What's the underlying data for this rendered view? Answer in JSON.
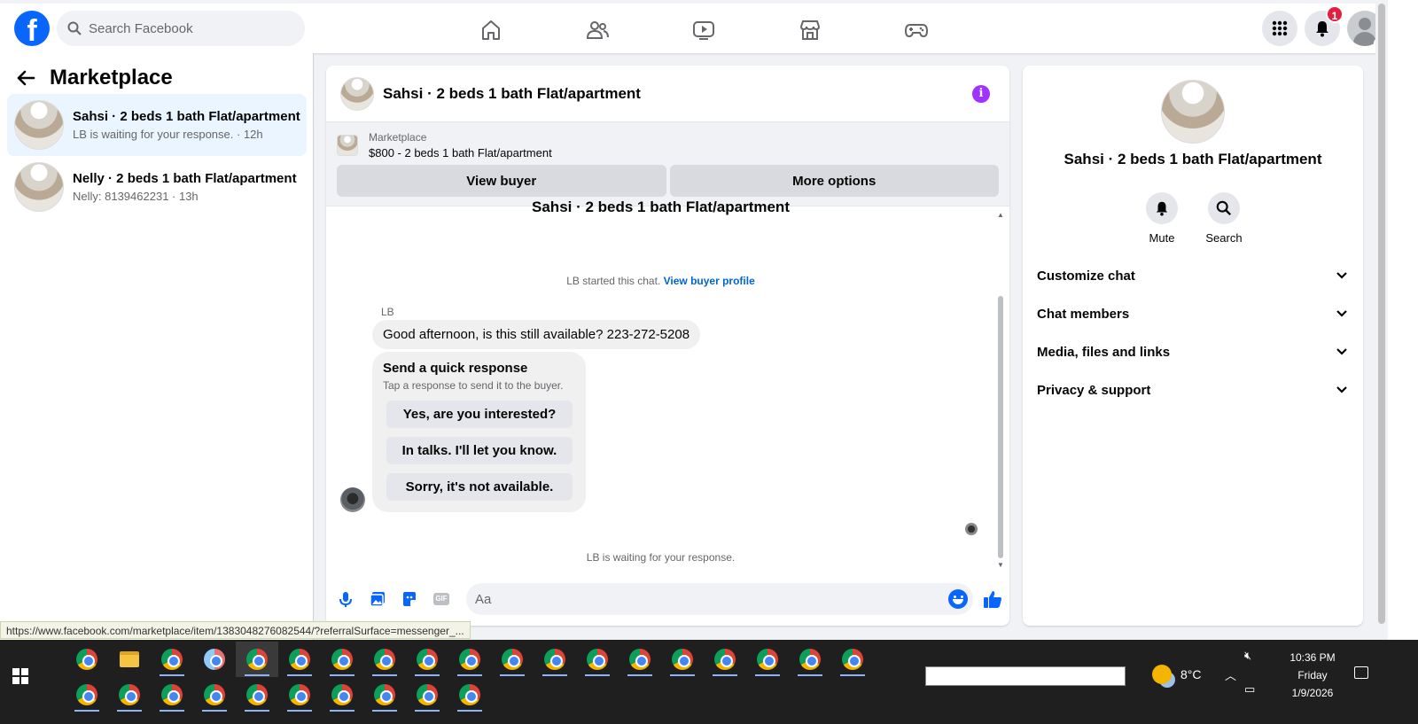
{
  "topbar": {
    "logo": "f",
    "search_placeholder": "Search Facebook",
    "notification_count": "1"
  },
  "left": {
    "title": "Marketplace",
    "conversations": [
      {
        "title": "Sahsi · 2 beds 1 bath Flat/apartment",
        "subtitle": "LB is waiting for your response. · 12h"
      },
      {
        "title": "Nelly · 2 beds 1 bath Flat/apartment",
        "subtitle": "Nelly: 8139462231 · 13h"
      }
    ]
  },
  "chat": {
    "title": "Sahsi · 2 beds 1 bath Flat/apartment",
    "info_icon": "i",
    "listing": {
      "label": "Marketplace",
      "price_line": "$800 - 2 beds 1 bath Flat/apartment",
      "view_buyer": "View buyer",
      "more_options": "More options"
    },
    "cut_title": "Sahsi · 2 beds 1 bath Flat/apartment",
    "started_text": "LB started this chat.",
    "started_link": "View buyer profile",
    "sender": "LB",
    "message": "Good afternoon, is this still available? 223-272-5208",
    "quick": {
      "title": "Send a quick response",
      "subtitle": "Tap a response to send it to the buyer.",
      "options": [
        "Yes, are you interested?",
        "In talks. I'll let you know.",
        "Sorry, it's not available."
      ]
    },
    "waiting": "LB is waiting for your response.",
    "composer_placeholder": "Aa",
    "gif_label": "GIF"
  },
  "info": {
    "title": "Sahsi · 2 beds 1 bath Flat/apartment",
    "mute": "Mute",
    "search": "Search",
    "sections": [
      "Customize chat",
      "Chat members",
      "Media, files and links",
      "Privacy & support"
    ]
  },
  "status_url": "https://www.facebook.com/marketplace/item/1383048276082544/?referralSurface=messenger_...",
  "taskbar": {
    "weather": "8°C",
    "time": "10:36 PM",
    "day": "Friday",
    "date": "1/9/2026"
  },
  "colors": {
    "brand": "#0866ff",
    "active_conv": "#ebf5ff",
    "info_purple": "#a033ff",
    "link": "#0064d1"
  }
}
